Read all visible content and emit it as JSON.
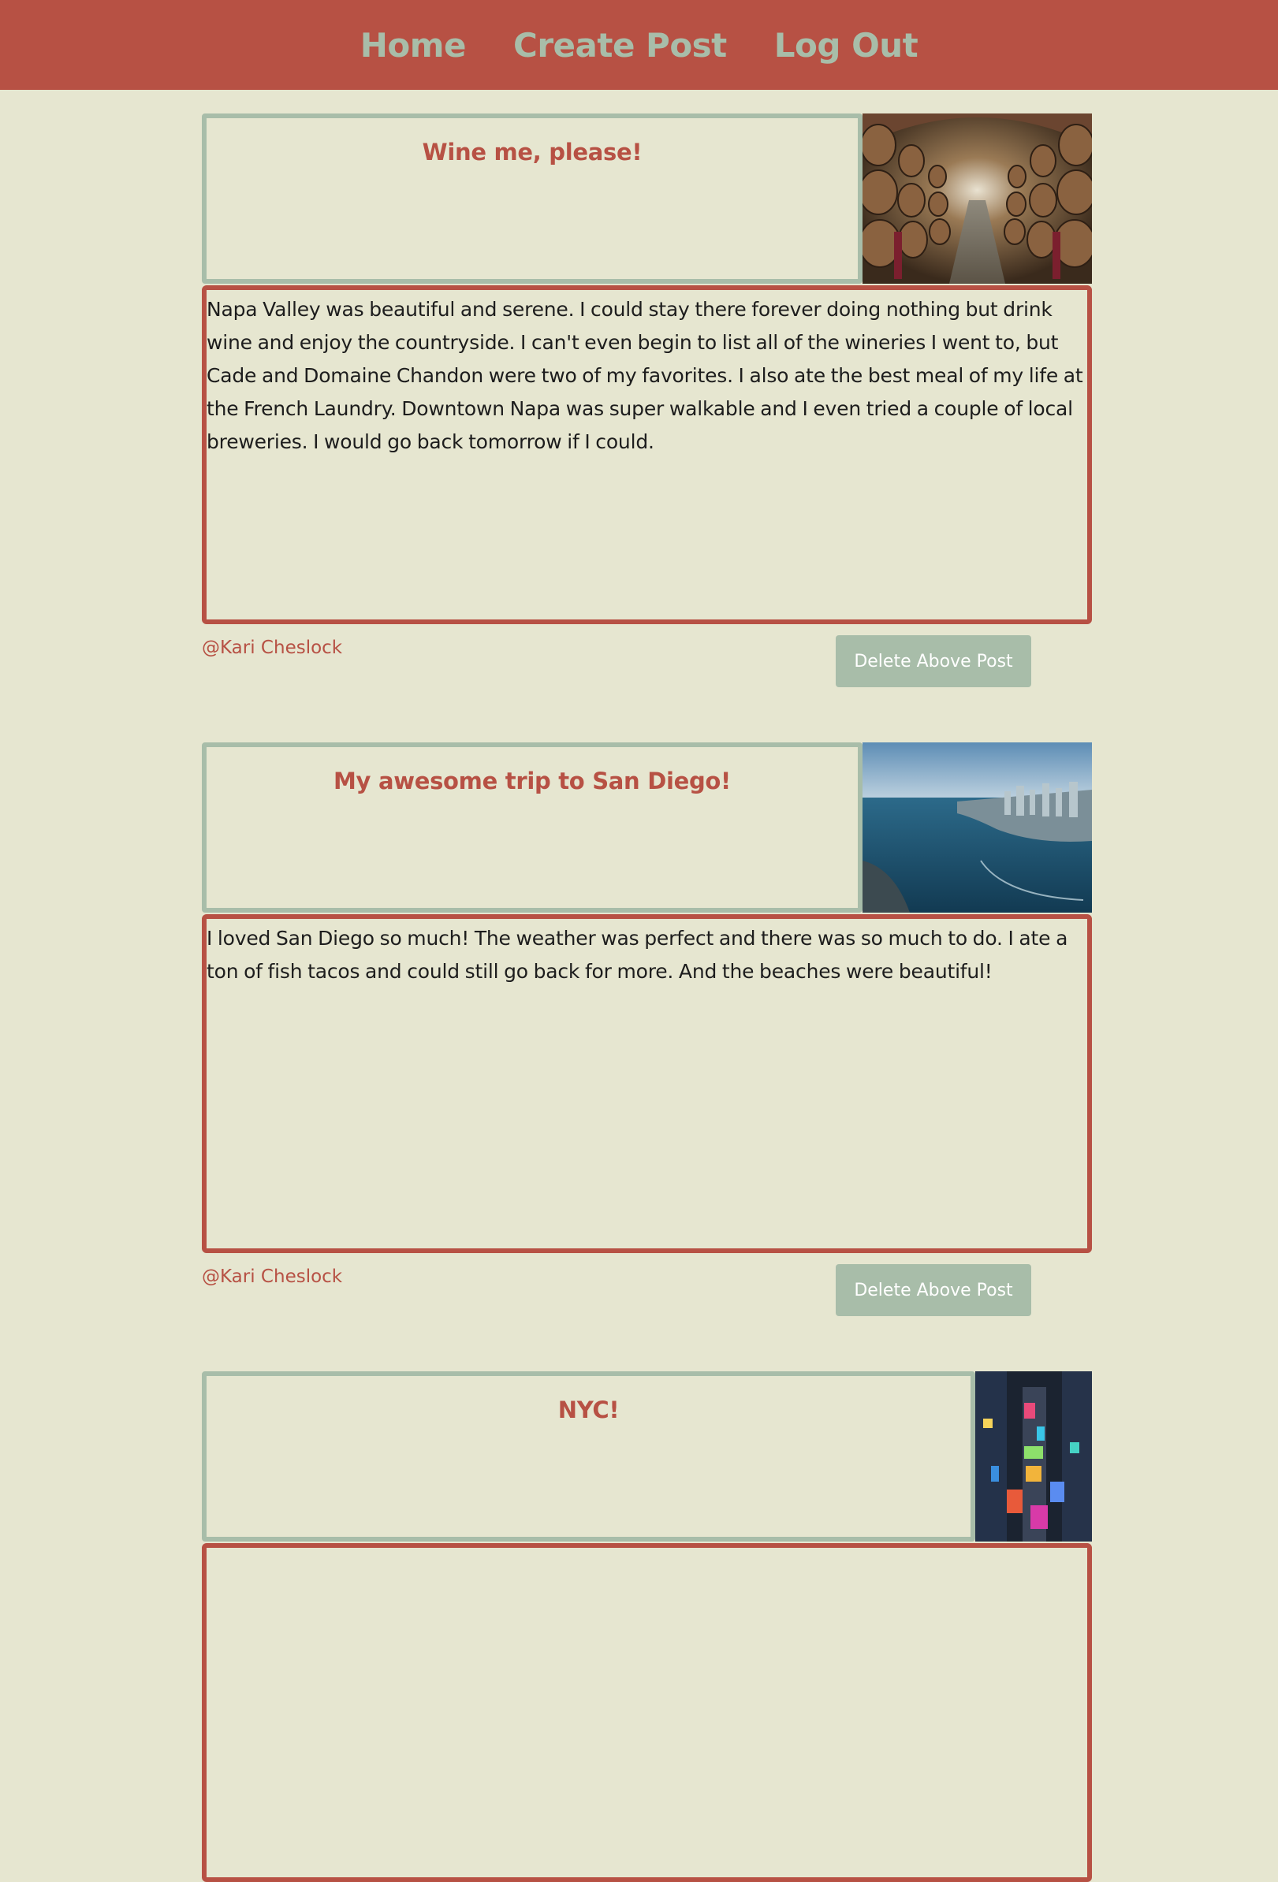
{
  "nav": {
    "items": [
      "Home",
      "Create Post",
      "Log Out"
    ]
  },
  "colors": {
    "header_bg": "#b75144",
    "nav_text": "#a8bda9",
    "page_bg": "#e6e6d0",
    "title_border": "#a8bda9",
    "body_border": "#b75144",
    "button_bg": "#a8bda9"
  },
  "posts": [
    {
      "title": "Wine me, please!",
      "image_alt": "wine cellar barrels",
      "body": "Napa Valley was beautiful and serene. I could stay there forever doing nothing but drink wine and enjoy the countryside. I can't even begin to list all of the wineries I went to, but Cade and Domaine Chandon were two of my favorites. I also ate the best meal of my life at the French Laundry. Downtown Napa was super walkable and I even tried a couple of local breweries. I would go back tomorrow if I could.",
      "author": "@Kari Cheslock",
      "delete_label": "Delete Above Post"
    },
    {
      "title": "My awesome trip to San Diego!",
      "image_alt": "aerial view of San Diego bay",
      "body": "I loved San Diego so much! The weather was perfect and there was so much to do. I ate a ton of fish tacos and could still go back for more. And the beaches were beautiful!",
      "author": "@Kari Cheslock",
      "delete_label": "Delete Above Post"
    },
    {
      "title": "NYC!",
      "image_alt": "Times Square at night from above"
    }
  ]
}
